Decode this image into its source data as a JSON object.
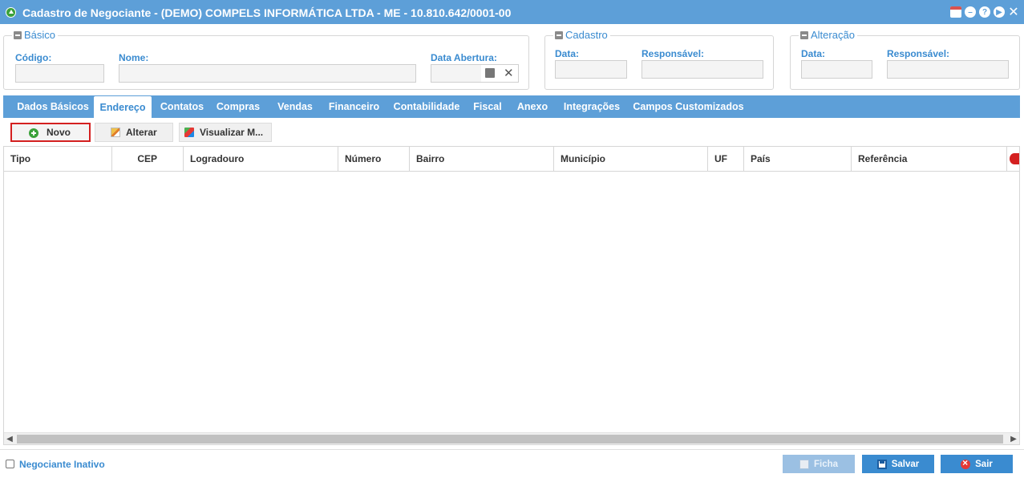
{
  "window": {
    "title": "Cadastro de Negociante - (DEMO) COMPELS INFORMÁTICA LTDA - ME - 10.810.642/0001-00"
  },
  "basico": {
    "legend": "Básico",
    "codigo_label": "Código:",
    "codigo_value": "",
    "nome_label": "Nome:",
    "nome_value": "",
    "data_abertura_label": "Data Abertura:",
    "data_abertura_value": ""
  },
  "cadastro": {
    "legend": "Cadastro",
    "data_label": "Data:",
    "responsavel_label": "Responsável:"
  },
  "alteracao": {
    "legend": "Alteração",
    "data_label": "Data:",
    "responsavel_label": "Responsável:"
  },
  "tabs": [
    {
      "label": "Dados Básicos",
      "active": false
    },
    {
      "label": "Endereço",
      "active": true
    },
    {
      "label": "Contatos",
      "active": false
    },
    {
      "label": "Compras",
      "active": false
    },
    {
      "label": "Vendas",
      "active": false
    },
    {
      "label": "Financeiro",
      "active": false
    },
    {
      "label": "Contabilidade",
      "active": false
    },
    {
      "label": "Fiscal",
      "active": false
    },
    {
      "label": "Anexo",
      "active": false
    },
    {
      "label": "Integrações",
      "active": false
    },
    {
      "label": "Campos Customizados",
      "active": false
    }
  ],
  "toolbar": {
    "novo": "Novo",
    "alterar": "Alterar",
    "visualizar": "Visualizar M..."
  },
  "grid": {
    "columns": [
      "Tipo",
      "CEP",
      "Logradouro",
      "Número",
      "Bairro",
      "Município",
      "UF",
      "País",
      "Referência"
    ],
    "rows": []
  },
  "footer": {
    "inativo_label": "Negociante Inativo",
    "inativo_checked": false,
    "ficha": "Ficha",
    "salvar": "Salvar",
    "sair": "Sair"
  },
  "colors": {
    "accent": "#5d9fd8",
    "label": "#3a8bd0",
    "highlight": "#d42020"
  }
}
